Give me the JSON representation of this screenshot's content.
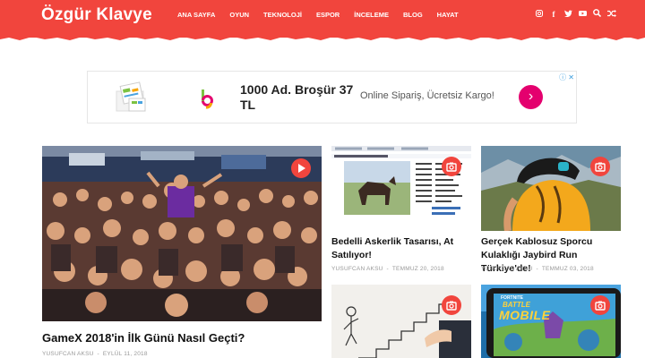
{
  "site": {
    "logo": "Özgür Klavye"
  },
  "nav": {
    "items": [
      "ANA SAYFA",
      "OYUN",
      "TEKNOLOJİ",
      "ESPOR",
      "İNCELEME",
      "BLOG",
      "HAYAT"
    ]
  },
  "social_icons": [
    "instagram-icon",
    "facebook-icon",
    "twitter-icon",
    "youtube-icon",
    "search-icon",
    "shuffle-icon"
  ],
  "ad": {
    "title": "1000 Ad. Broşür 37 TL",
    "subtitle": "Online Sipariş, Ücretsiz Kargo!",
    "cta_icon": "chevron-right-icon",
    "marks": "ⓘ ✕",
    "accent": "#e4006e"
  },
  "colors": {
    "brand": "#f1453d"
  },
  "posts": [
    {
      "title": "GameX 2018'in İlk Günü Nasıl Geçti?",
      "author": "YUSUFCAN AKSU",
      "date": "EYLÜL 11, 2018",
      "badge": "play-icon"
    },
    {
      "title": "Bedelli Askerlik Tasarısı, At Satılıyor!",
      "author": "YUSUFCAN AKSU",
      "date": "TEMMUZ 20, 2018",
      "badge": "camera-icon"
    },
    {
      "title": "Gerçek Kablosuz Sporcu Kulaklığı Jaybird Run Türkiye'de!",
      "author": "YUSUFCAN AKSU",
      "date": "TEMMUZ 03, 2018",
      "badge": "camera-icon"
    },
    {
      "title": "",
      "author": "",
      "date": "",
      "badge": "camera-icon"
    },
    {
      "title": "",
      "author": "",
      "date": "",
      "badge": "camera-icon"
    }
  ],
  "thumb_texts": {
    "battle_title": "BATTLE",
    "battle_sub": "MOBILE",
    "fortnite": "FORTNITE"
  }
}
